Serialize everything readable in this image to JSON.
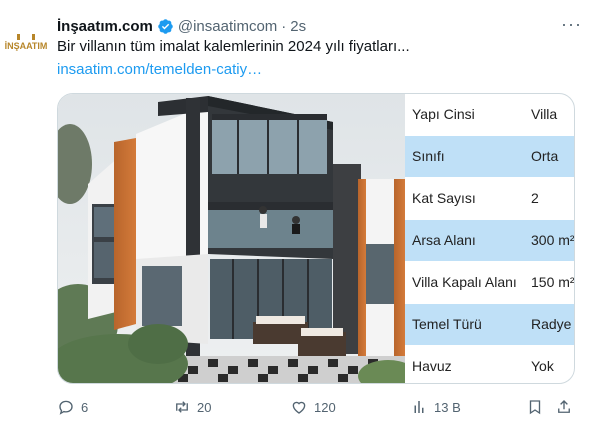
{
  "tweet": {
    "author_name": "İnşaatım.com",
    "handle": "@insaatimcom",
    "separator": "·",
    "time": "2s",
    "text": "Bir villanın tüm imalat kalemlerinin 2024 yılı fiyatları...",
    "link": "insaatim.com/temelden-catiy…",
    "avatar_logo_text": "İNŞAATIM",
    "verified_color": "#1d9bf0"
  },
  "table": {
    "rows": [
      {
        "key": "Yapı Cinsi",
        "value": "Villa",
        "highlight": false
      },
      {
        "key": "Sınıfı",
        "value": "Orta",
        "highlight": true
      },
      {
        "key": "Kat Sayısı",
        "value": "2",
        "highlight": false
      },
      {
        "key": "Arsa Alanı",
        "value": "300 m²",
        "highlight": true
      },
      {
        "key": "Villa Kapalı Alanı",
        "value": "150 m²",
        "highlight": false
      },
      {
        "key": "Temel Türü",
        "value": "Radye",
        "highlight": true
      },
      {
        "key": "Havuz",
        "value": "Yok",
        "highlight": false
      }
    ]
  },
  "actions": {
    "reply_count": "6",
    "retweet_count": "20",
    "like_count": "120",
    "views_count": "13 B"
  }
}
